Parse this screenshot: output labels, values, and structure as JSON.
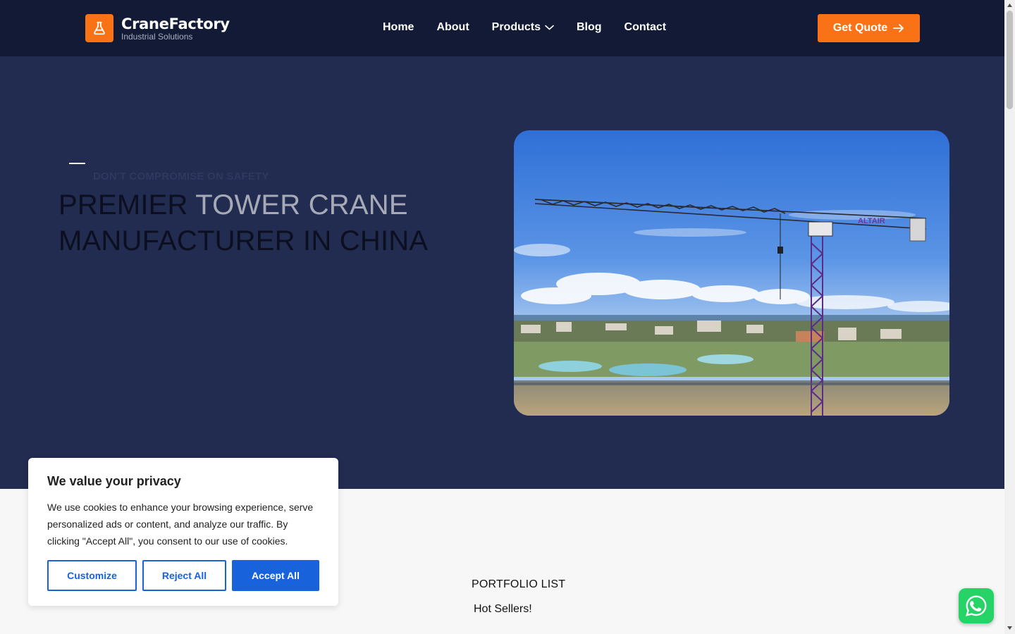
{
  "header": {
    "logo_title": "CraneFactory",
    "logo_subtitle": "Industrial Solutions",
    "nav": [
      {
        "label": "Home"
      },
      {
        "label": "About"
      },
      {
        "label": "Products",
        "has_dropdown": true
      },
      {
        "label": "Blog"
      },
      {
        "label": "Contact"
      }
    ],
    "cta_label": "Get Quote"
  },
  "hero": {
    "tagline": "DON'T COMPROMISE ON SAFETY",
    "title_part1": "PREMIER ",
    "title_highlight": "TOWER CRANE",
    "title_part2": "MANUFACTURER IN CHINA",
    "image_text": "ALTAIR"
  },
  "section": {
    "label": "PORTFOLIO LIST",
    "subtitle": "Hot Sellers!"
  },
  "cookie": {
    "title": "We value your privacy",
    "text": "We use cookies to enhance your browsing experience, serve personalized ads or content, and analyze our traffic. By clicking \"Accept All\", you consent to our use of cookies.",
    "customize_label": "Customize",
    "reject_label": "Reject All",
    "accept_label": "Accept All"
  },
  "colors": {
    "header_bg": "#121a35",
    "hero_bg": "#222b50",
    "accent": "#f97316",
    "cookie_blue": "#1863dc",
    "whatsapp": "#25d366"
  },
  "icons": {
    "logo": "flask-icon",
    "dropdown": "chevron-down-icon",
    "cta": "arrow-right-icon",
    "chat": "whatsapp-icon"
  }
}
